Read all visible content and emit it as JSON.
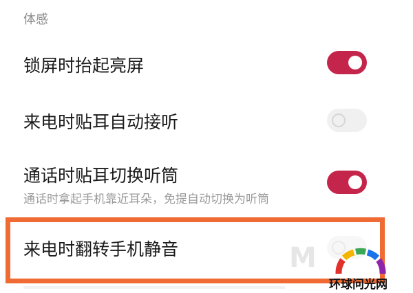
{
  "section_header": "体感",
  "settings": [
    {
      "title": "锁屏时抬起亮屏",
      "subtitle": "",
      "enabled": true
    },
    {
      "title": "来电时贴耳自动接听",
      "subtitle": "",
      "enabled": false
    },
    {
      "title": "通话时贴耳切换听筒",
      "subtitle": "通话时拿起手机靠近耳朵，免提自动切换为听筒",
      "enabled": true
    },
    {
      "title": "来电时翻转手机静音",
      "subtitle": "",
      "enabled": false
    }
  ],
  "watermark": {
    "site_name": "环球问光网",
    "letter": "M"
  },
  "colors": {
    "toggle_on": "#c4254a",
    "toggle_off": "#f0f0f0",
    "highlight": "#ef6b33"
  }
}
